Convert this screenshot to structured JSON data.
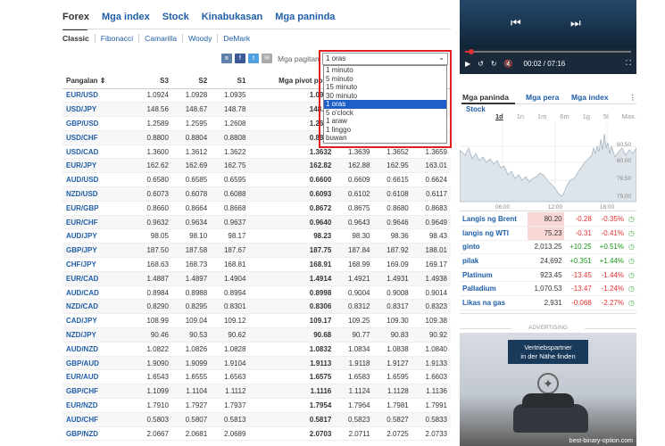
{
  "main_tabs": [
    "Forex",
    "Mga index",
    "Stock",
    "Kinabukasan",
    "Mga paninda"
  ],
  "sub_tabs": [
    "Classic",
    "Fibonacci",
    "Camarilla",
    "Woody",
    "DeMark"
  ],
  "share_icons": [
    "vk-icon",
    "facebook-icon",
    "twitter-icon",
    "mail-icon"
  ],
  "period": {
    "label": "Mga pagitan",
    "selected": "1 oras",
    "options": [
      "1 minuto",
      "5 minuto",
      "15 minuto",
      "30 minuto",
      "1 oras",
      "5 o'clock",
      "1 araw",
      "1 linggo",
      "buwan"
    ]
  },
  "table": {
    "headers": [
      "Pangalan ⇕",
      "S3",
      "S2",
      "S1",
      "Mga pivot point",
      "R1",
      "R2",
      "R3"
    ],
    "rows": [
      [
        "EUR/USD",
        "1.0924",
        "1.0928",
        "1.0935",
        "1.0939",
        "",
        "",
        ""
      ],
      [
        "USD/JPY",
        "148.56",
        "148.67",
        "148.78",
        "148.86",
        "",
        "",
        ""
      ],
      [
        "GBP/USD",
        "1.2589",
        "1.2595",
        "1.2608",
        "1.2615",
        "",
        "",
        ""
      ],
      [
        "USD/CHF",
        "0.8800",
        "0.8804",
        "0.8808",
        "0.8812",
        "",
        "",
        ""
      ],
      [
        "USD/CAD",
        "1.3600",
        "1.3612",
        "1.3622",
        "1.3632",
        "1.3639",
        "1.3652",
        "1.3659"
      ],
      [
        "EUR/JPY",
        "162.62",
        "162.69",
        "162.75",
        "162.82",
        "162.88",
        "162.95",
        "163.01"
      ],
      [
        "AUD/USD",
        "0.6580",
        "0.6585",
        "0.6595",
        "0.6600",
        "0.6609",
        "0.6615",
        "0.6624"
      ],
      [
        "NZD/USD",
        "0.6073",
        "0.6078",
        "0.6088",
        "0.6093",
        "0.6102",
        "0.6108",
        "0.6117"
      ],
      [
        "EUR/GBP",
        "0.8660",
        "0.8664",
        "0.8668",
        "0.8672",
        "0.8675",
        "0.8680",
        "0.8683"
      ],
      [
        "EUR/CHF",
        "0.9632",
        "0.9634",
        "0.9637",
        "0.9640",
        "0.9643",
        "0.9646",
        "0.9649"
      ],
      [
        "AUD/JPY",
        "98.05",
        "98.10",
        "98.17",
        "98.23",
        "98.30",
        "98.36",
        "98.43"
      ],
      [
        "GBP/JPY",
        "187.50",
        "187.58",
        "187.67",
        "187.75",
        "187.84",
        "187.92",
        "188.01"
      ],
      [
        "CHF/JPY",
        "168.63",
        "168.73",
        "168.81",
        "168.91",
        "168.99",
        "169.09",
        "169.17"
      ],
      [
        "EUR/CAD",
        "1.4887",
        "1.4897",
        "1.4904",
        "1.4914",
        "1.4921",
        "1.4931",
        "1.4938"
      ],
      [
        "AUD/CAD",
        "0.8984",
        "0.8988",
        "0.8994",
        "0.8998",
        "0.9004",
        "0.9008",
        "0.9014"
      ],
      [
        "NZD/CAD",
        "0.8290",
        "0.8295",
        "0.8301",
        "0.8306",
        "0.8312",
        "0.8317",
        "0.8323"
      ],
      [
        "CAD/JPY",
        "108.99",
        "109.04",
        "109.12",
        "109.17",
        "109.25",
        "109.30",
        "109.38"
      ],
      [
        "NZD/JPY",
        "90.46",
        "90.53",
        "90.62",
        "90.68",
        "90.77",
        "90.83",
        "90.92"
      ],
      [
        "AUD/NZD",
        "1.0822",
        "1.0826",
        "1.0828",
        "1.0832",
        "1.0834",
        "1.0838",
        "1.0840"
      ],
      [
        "GBP/AUD",
        "1.9090",
        "1.9099",
        "1.9104",
        "1.9113",
        "1.9118",
        "1.9127",
        "1.9133"
      ],
      [
        "EUR/AUD",
        "1.6543",
        "1.6555",
        "1.6563",
        "1.6575",
        "1.6583",
        "1.6595",
        "1.6603"
      ],
      [
        "GBP/CHF",
        "1.1099",
        "1.1104",
        "1.1112",
        "1.1116",
        "1.1124",
        "1.1128",
        "1.1136"
      ],
      [
        "EUR/NZD",
        "1.7910",
        "1.7927",
        "1.7937",
        "1.7954",
        "1.7964",
        "1.7981",
        "1.7991"
      ],
      [
        "AUD/CHF",
        "0.5803",
        "0.5807",
        "0.5813",
        "0.5817",
        "0.5823",
        "0.5827",
        "0.5833"
      ],
      [
        "GBP/NZD",
        "2.0667",
        "2.0681",
        "2.0689",
        "2.0703",
        "2.0711",
        "2.0725",
        "2.0733"
      ]
    ]
  },
  "video": {
    "time": "00:02 / 07:16",
    "progress": 0.005
  },
  "widget": {
    "tabs": [
      "Mga paninda",
      "Mga pera",
      "Mga index"
    ],
    "category": "Stock",
    "ranges": [
      "1d",
      "1n",
      "1m",
      "6m",
      "1g",
      "5l",
      "Max."
    ],
    "active_range": "1d",
    "chart_y_labels": [
      "80,50",
      "80,00",
      "79,50",
      "79,00"
    ],
    "chart_x_labels": [
      "06:00",
      "12:00",
      "18:00"
    ],
    "items": [
      [
        "Langis ng Brent",
        "80.20",
        "-0.28",
        "-0.35%"
      ],
      [
        "langis ng WTI",
        "75.23",
        "-0.31",
        "-0.41%"
      ],
      [
        "ginto",
        "2,013.25",
        "+10.25",
        "+0.51%"
      ],
      [
        "pilak",
        "24,692",
        "+0.351",
        "+1.44%"
      ],
      [
        "Platinum",
        "923.45",
        "-13.45",
        "-1.44%"
      ],
      [
        "Palladium",
        "1,070.53",
        "-13.47",
        "-1.24%"
      ],
      [
        "Likas na gas",
        "2,931",
        "-0.068",
        "-2.27%"
      ]
    ]
  },
  "ad": {
    "label": "ADVERTISING",
    "headline_1": "Vertriebspartner",
    "headline_2": "in der Nähe finden",
    "watermark": "best-binary-option.com"
  }
}
